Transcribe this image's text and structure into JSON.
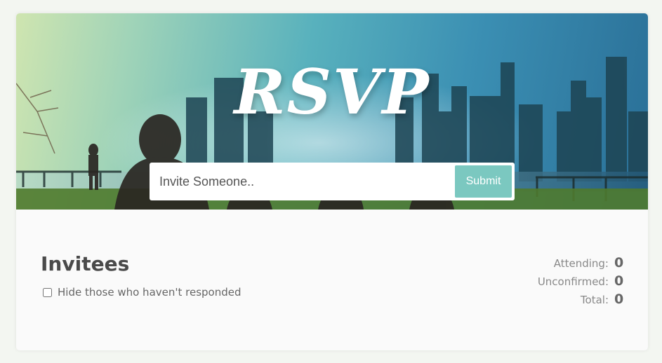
{
  "hero": {
    "title": "RSVP",
    "colors": {
      "sky_left": "#cfe5b0",
      "sky_mid": "#58b1bd",
      "sky_right": "#2a6f97",
      "skyline": "#153845",
      "grass": "#4f7a2d"
    }
  },
  "invite": {
    "placeholder": "Invite Someone..",
    "submit_label": "Submit",
    "submit_color": "#7bc8c0"
  },
  "invitees": {
    "heading": "Invitees",
    "filter_label": "Hide those who haven't responded",
    "filter_checked": false
  },
  "stats": [
    {
      "label": "Attending:",
      "value": "0"
    },
    {
      "label": "Unconfirmed:",
      "value": "0"
    },
    {
      "label": "Total:",
      "value": "0"
    }
  ]
}
